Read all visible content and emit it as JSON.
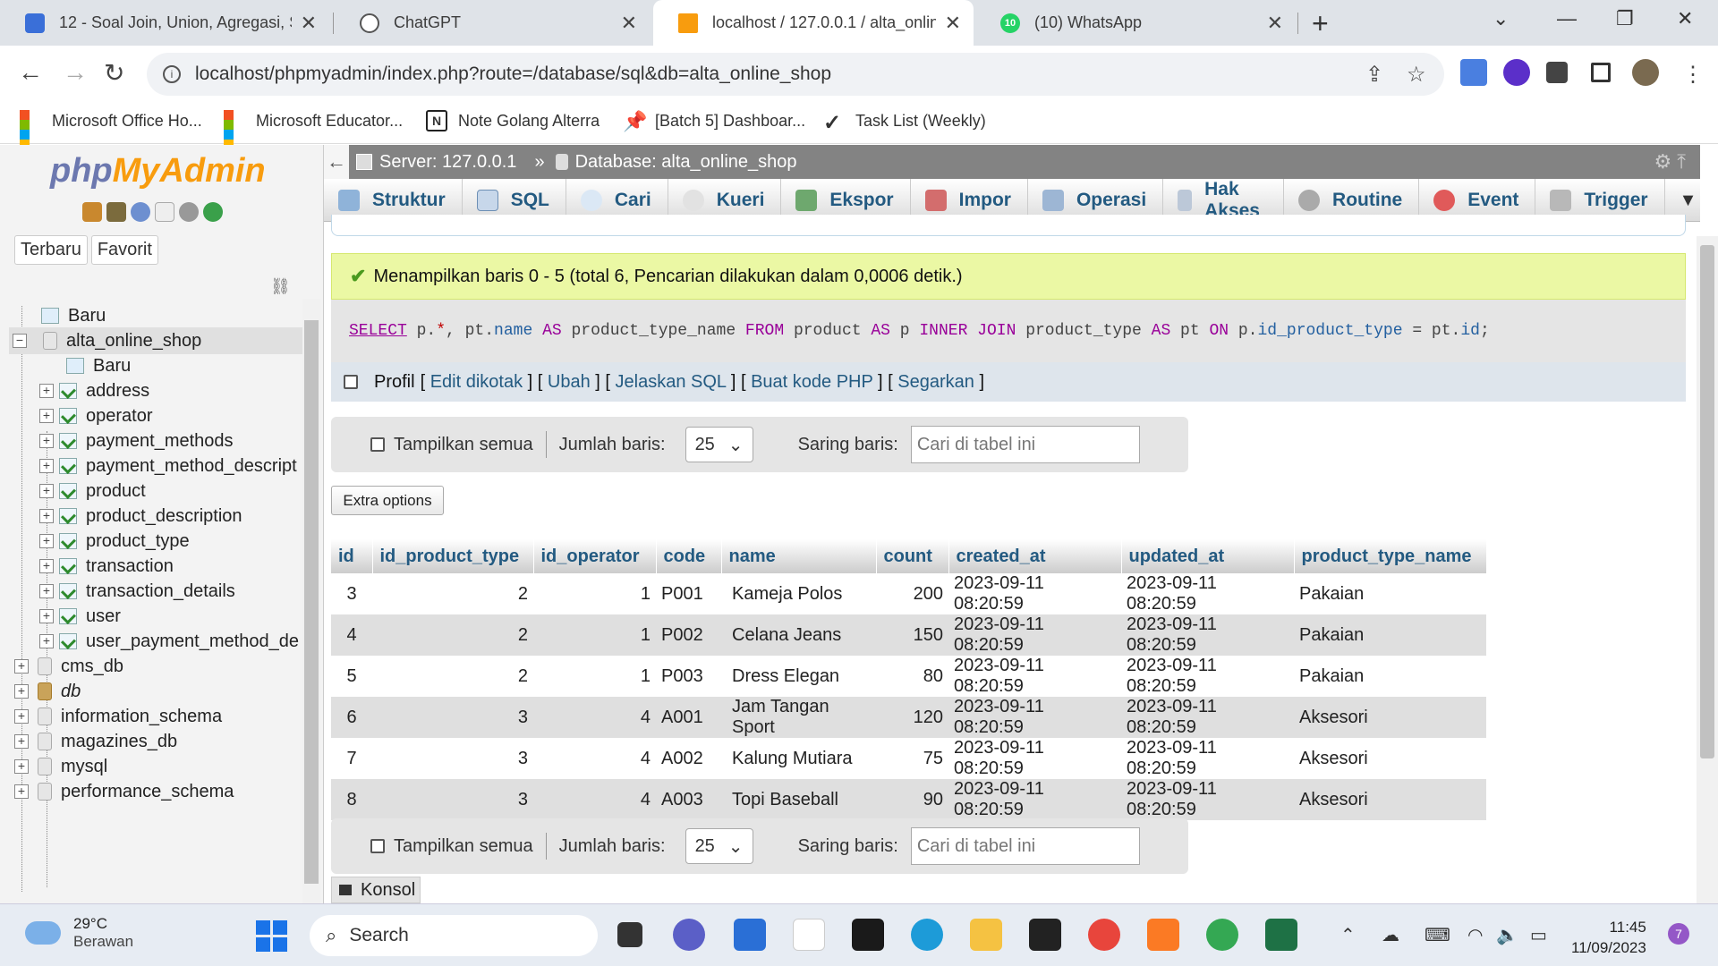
{
  "browser": {
    "tabs": [
      {
        "title": "12 - Soal Join, Union, Agregasi, S",
        "active": false
      },
      {
        "title": "ChatGPT",
        "active": false
      },
      {
        "title": "localhost / 127.0.0.1 / alta_online",
        "active": true
      },
      {
        "title": "(10) WhatsApp",
        "active": false
      }
    ],
    "whatsapp_badge": "10",
    "url": "localhost/phpmyadmin/index.php?route=/database/sql&db=alta_online_shop",
    "bookmarks": [
      "Microsoft Office Ho...",
      "Microsoft Educator...",
      "Note Golang Alterra",
      "[Batch 5] Dashboar...",
      "Task List (Weekly)"
    ]
  },
  "sidebar": {
    "logo_php": "php",
    "logo_ma": "MyAdmin",
    "tabs": [
      "Terbaru",
      "Favorit"
    ],
    "tree": [
      {
        "label": "Baru",
        "level": 0,
        "kind": "new"
      },
      {
        "label": "alta_online_shop",
        "level": 0,
        "kind": "db",
        "expanded": true
      },
      {
        "label": "Baru",
        "level": 1,
        "kind": "new"
      },
      {
        "label": "address",
        "level": 1,
        "kind": "table"
      },
      {
        "label": "operator",
        "level": 1,
        "kind": "table"
      },
      {
        "label": "payment_methods",
        "level": 1,
        "kind": "table"
      },
      {
        "label": "payment_method_descript",
        "level": 1,
        "kind": "table"
      },
      {
        "label": "product",
        "level": 1,
        "kind": "table"
      },
      {
        "label": "product_description",
        "level": 1,
        "kind": "table"
      },
      {
        "label": "product_type",
        "level": 1,
        "kind": "table"
      },
      {
        "label": "transaction",
        "level": 1,
        "kind": "table"
      },
      {
        "label": "transaction_details",
        "level": 1,
        "kind": "table"
      },
      {
        "label": "user",
        "level": 1,
        "kind": "table"
      },
      {
        "label": "user_payment_method_de",
        "level": 1,
        "kind": "table"
      },
      {
        "label": "cms_db",
        "level": 0,
        "kind": "db"
      },
      {
        "label": "db",
        "level": 0,
        "kind": "db-alt"
      },
      {
        "label": "information_schema",
        "level": 0,
        "kind": "db"
      },
      {
        "label": "magazines_db",
        "level": 0,
        "kind": "db"
      },
      {
        "label": "mysql",
        "level": 0,
        "kind": "db"
      },
      {
        "label": "performance_schema",
        "level": 0,
        "kind": "db"
      }
    ]
  },
  "topbar": {
    "server": "Server: 127.0.0.1",
    "separator": "»",
    "database": "Database: alta_online_shop"
  },
  "menu": [
    "Struktur",
    "SQL",
    "Cari",
    "Kueri",
    "Ekspor",
    "Impor",
    "Operasi",
    "Hak Akses",
    "Routine",
    "Event",
    "Trigger"
  ],
  "message": "Menampilkan baris 0 - 5 (total 6, Pencarian dilakukan dalam 0,0006 detik.)",
  "sql_tokens": [
    {
      "t": "SELECT",
      "c": "kw ul"
    },
    {
      "t": " p.",
      "c": ""
    },
    {
      "t": "*",
      "c": "star"
    },
    {
      "t": ", pt.",
      "c": ""
    },
    {
      "t": "name",
      "c": "id"
    },
    {
      "t": " ",
      "c": ""
    },
    {
      "t": "AS",
      "c": "kw"
    },
    {
      "t": " product_type_name ",
      "c": ""
    },
    {
      "t": "FROM",
      "c": "kw"
    },
    {
      "t": " product ",
      "c": ""
    },
    {
      "t": "AS",
      "c": "kw"
    },
    {
      "t": " p ",
      "c": ""
    },
    {
      "t": "INNER JOIN",
      "c": "kw"
    },
    {
      "t": " product_type ",
      "c": ""
    },
    {
      "t": "AS",
      "c": "kw"
    },
    {
      "t": " pt ",
      "c": ""
    },
    {
      "t": "ON",
      "c": "kw"
    },
    {
      "t": " p.",
      "c": ""
    },
    {
      "t": "id_product_type",
      "c": "id"
    },
    {
      "t": " = pt.",
      "c": ""
    },
    {
      "t": "id",
      "c": "id"
    },
    {
      "t": ";",
      "c": ""
    }
  ],
  "profil": {
    "label": "Profil",
    "links": [
      "Edit dikotak",
      "Ubah",
      "Jelaskan SQL",
      "Buat kode PHP",
      "Segarkan"
    ]
  },
  "navigation": {
    "show_all": "Tampilkan semua",
    "rows_label": "Jumlah baris:",
    "rows_value": "25",
    "filter_label": "Saring baris:",
    "filter_placeholder": "Cari di tabel ini"
  },
  "extra_options": "Extra options",
  "results": {
    "columns": [
      "id",
      "id_product_type",
      "id_operator",
      "code",
      "name",
      "count",
      "created_at",
      "updated_at",
      "product_type_name"
    ],
    "rows": [
      [
        "3",
        "2",
        "1",
        "P001",
        "Kameja Polos",
        "200",
        "2023-09-11 08:20:59",
        "2023-09-11 08:20:59",
        "Pakaian"
      ],
      [
        "4",
        "2",
        "1",
        "P002",
        "Celana Jeans",
        "150",
        "2023-09-11 08:20:59",
        "2023-09-11 08:20:59",
        "Pakaian"
      ],
      [
        "5",
        "2",
        "1",
        "P003",
        "Dress Elegan",
        "80",
        "2023-09-11 08:20:59",
        "2023-09-11 08:20:59",
        "Pakaian"
      ],
      [
        "6",
        "3",
        "4",
        "A001",
        "Jam Tangan Sport",
        "120",
        "2023-09-11 08:20:59",
        "2023-09-11 08:20:59",
        "Aksesori"
      ],
      [
        "7",
        "3",
        "4",
        "A002",
        "Kalung Mutiara",
        "75",
        "2023-09-11 08:20:59",
        "2023-09-11 08:20:59",
        "Aksesori"
      ],
      [
        "8",
        "3",
        "4",
        "A003",
        "Topi Baseball",
        "90",
        "2023-09-11 08:20:59",
        "2023-09-11 08:20:59",
        "Aksesori"
      ]
    ]
  },
  "konsol": "Konsol",
  "taskbar": {
    "temp": "29°C",
    "weather": "Berawan",
    "search": "Search",
    "time": "11:45",
    "date": "11/09/2023",
    "notifications": "7"
  }
}
